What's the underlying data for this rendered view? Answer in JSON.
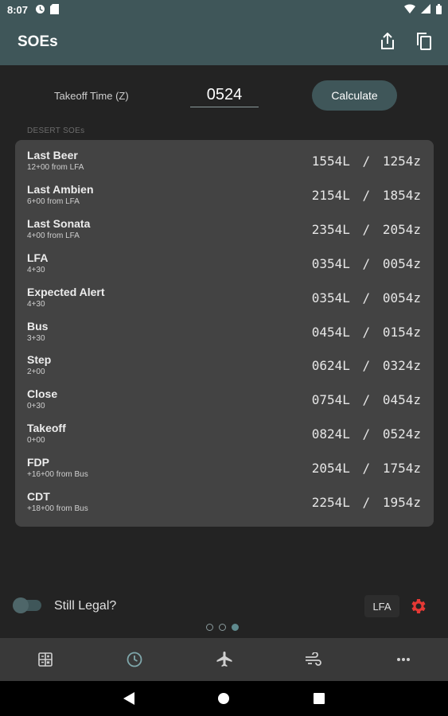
{
  "status": {
    "time": "8:07"
  },
  "appbar": {
    "title": "SOEs"
  },
  "takeoff": {
    "label": "Takeoff Time (Z)",
    "value": "0524",
    "button": "Calculate"
  },
  "section": {
    "label": "DESERT SOEs"
  },
  "rows": [
    {
      "name": "Last Beer",
      "sub": "12+00 from LFA",
      "local": "1554L",
      "zulu": "1254z"
    },
    {
      "name": "Last Ambien",
      "sub": "6+00 from LFA",
      "local": "2154L",
      "zulu": "1854z"
    },
    {
      "name": "Last Sonata",
      "sub": "4+00 from LFA",
      "local": "2354L",
      "zulu": "2054z"
    },
    {
      "name": "LFA",
      "sub": "4+30",
      "local": "0354L",
      "zulu": "0054z"
    },
    {
      "name": "Expected Alert",
      "sub": "4+30",
      "local": "0354L",
      "zulu": "0054z"
    },
    {
      "name": "Bus",
      "sub": "3+30",
      "local": "0454L",
      "zulu": "0154z"
    },
    {
      "name": "Step",
      "sub": "2+00",
      "local": "0624L",
      "zulu": "0324z"
    },
    {
      "name": "Close",
      "sub": "0+30",
      "local": "0754L",
      "zulu": "0454z"
    },
    {
      "name": "Takeoff",
      "sub": "0+00",
      "local": "0824L",
      "zulu": "0524z"
    },
    {
      "name": "FDP",
      "sub": "+16+00 from Bus",
      "local": "2054L",
      "zulu": "1754z"
    },
    {
      "name": "CDT",
      "sub": "+18+00 from Bus",
      "local": "2254L",
      "zulu": "1954z"
    }
  ],
  "legal": {
    "label": "Still Legal?",
    "chip": "LFA"
  },
  "colors": {
    "appbar": "#3f5659",
    "accent": "#5f8a8e",
    "gear": "#e53935"
  },
  "icons": {
    "share": "share-icon",
    "copy": "copy-icon",
    "gear": "gear-icon",
    "nav": [
      "calculator-icon",
      "clock-icon",
      "airplane-icon",
      "wind-icon",
      "more-icon"
    ]
  }
}
